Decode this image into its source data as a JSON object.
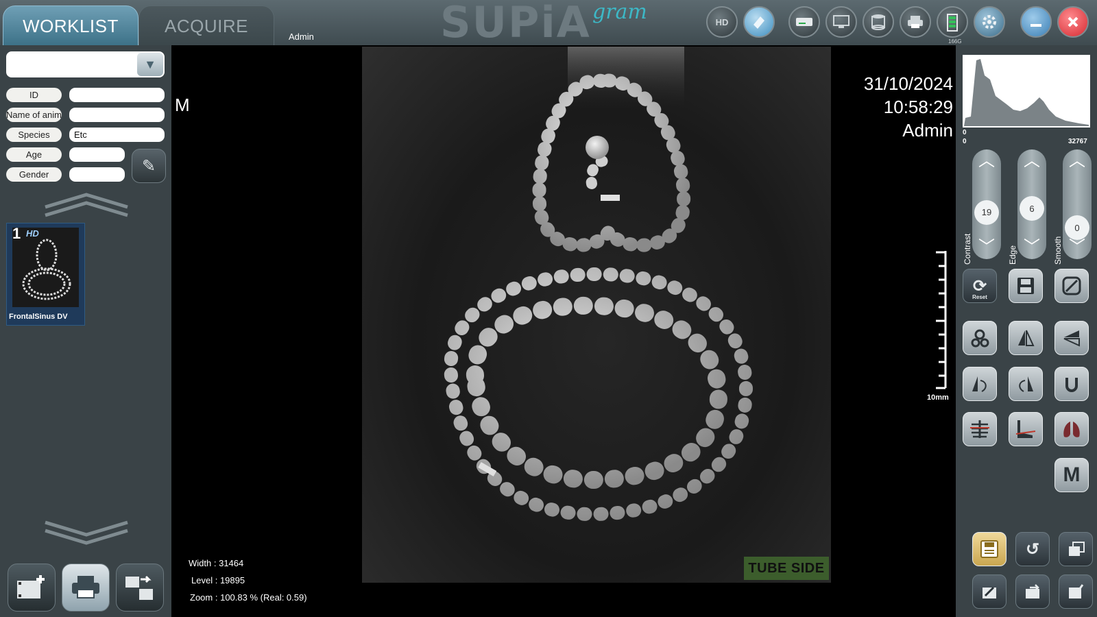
{
  "header": {
    "tabs": [
      {
        "label": "WORKLIST",
        "active": true
      },
      {
        "label": "ACQUIRE",
        "active": false
      }
    ],
    "user": "Admin",
    "logo_main": "SUPiA",
    "logo_script": "gram",
    "toolbar_icons": [
      "hd-icon",
      "eraser-icon",
      "scanner-icon",
      "monitor-icon",
      "database-icon",
      "printer-icon",
      "battery-icon",
      "settings-icon",
      "minimize-icon",
      "close-icon"
    ],
    "hd_label": "HD",
    "disk_label": "166G",
    "accent_color": "#3db8c6",
    "close_color": "#e8343b"
  },
  "patient": {
    "fields": [
      {
        "label": "ID",
        "value": ""
      },
      {
        "label": "Name of animal",
        "value": ""
      },
      {
        "label": "Species",
        "value": "Etc"
      },
      {
        "label": "Age",
        "value": ""
      },
      {
        "label": "Gender",
        "value": ""
      }
    ]
  },
  "thumbnail": {
    "number": "1",
    "badge": "HD",
    "caption": "FrontalSinus DV"
  },
  "viewer": {
    "orientation_marker": "M",
    "date": "31/10/2024",
    "time": "10:58:29",
    "operator": "Admin",
    "ruler_label": "10mm",
    "width_label": "Width :",
    "width_value": "31464",
    "level_label": "Level :",
    "level_value": "19895",
    "zoom_label": "Zoom :",
    "zoom_value": "100.83 % (Real: 0.59)",
    "tube_side": "TUBE SIDE"
  },
  "histogram": {
    "min_x": "0",
    "max_x": "32767",
    "min_y": "0"
  },
  "sliders": [
    {
      "label": "Contrast",
      "value": "19",
      "level": 0.4
    },
    {
      "label": "Edge",
      "value": "6",
      "level": 0.5
    },
    {
      "label": "Smooth",
      "value": "0",
      "level": 0.0
    }
  ],
  "tools": {
    "reset_label": "Reset",
    "m_label": "M"
  }
}
